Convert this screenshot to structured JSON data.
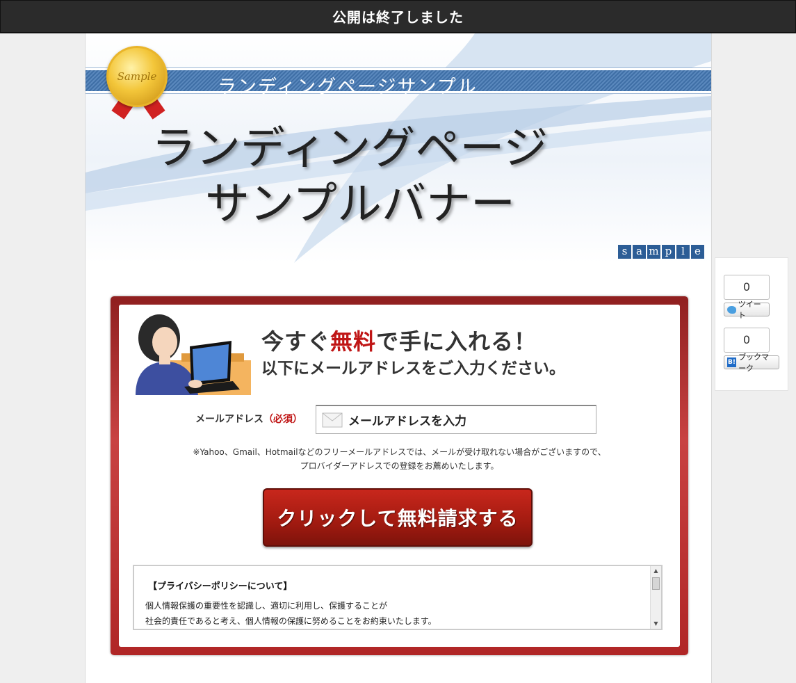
{
  "topbar": {
    "text": "公開は終了しました"
  },
  "banner": {
    "medal_text": "Sample",
    "subtitle": "ランディングページサンプル",
    "title_line1": "ランディングページ",
    "title_line2": "サンプルバナー",
    "sample_letters": [
      "s",
      "a",
      "m",
      "p",
      "l",
      "e"
    ]
  },
  "form": {
    "headline_pre": "今すぐ",
    "headline_red": "無料",
    "headline_post": "で手に入れる！",
    "subline": "以下にメールアドレスをご入力ください。",
    "email_label": "メールアドレス",
    "email_required": "（必須）",
    "email_placeholder": "メールアドレスを入力",
    "note_line1": "※Yahoo、Gmail、Hotmailなどのフリーメールアドレスでは、メールが受け取れない場合がございますので、",
    "note_line2": "プロバイダーアドレスでの登録をお薦めいたします。",
    "cta_label": "クリックして無料請求する"
  },
  "policy": {
    "title": "【プライバシーポリシーについて】",
    "line1": "個人情報保護の重要性を認識し、適切に利用し、保護することが",
    "line2": "社会的責任であると考え、個人情報の保護に努めることをお約束いたします。"
  },
  "social": {
    "tweet_count": "0",
    "tweet_label": "ツイート",
    "bookmark_count": "0",
    "bookmark_icon": "B!",
    "bookmark_label": "ブックマーク"
  },
  "colors": {
    "accent_red": "#c01616",
    "banner_blue": "#3f6fa6",
    "topbar": "#2b2b2b"
  }
}
